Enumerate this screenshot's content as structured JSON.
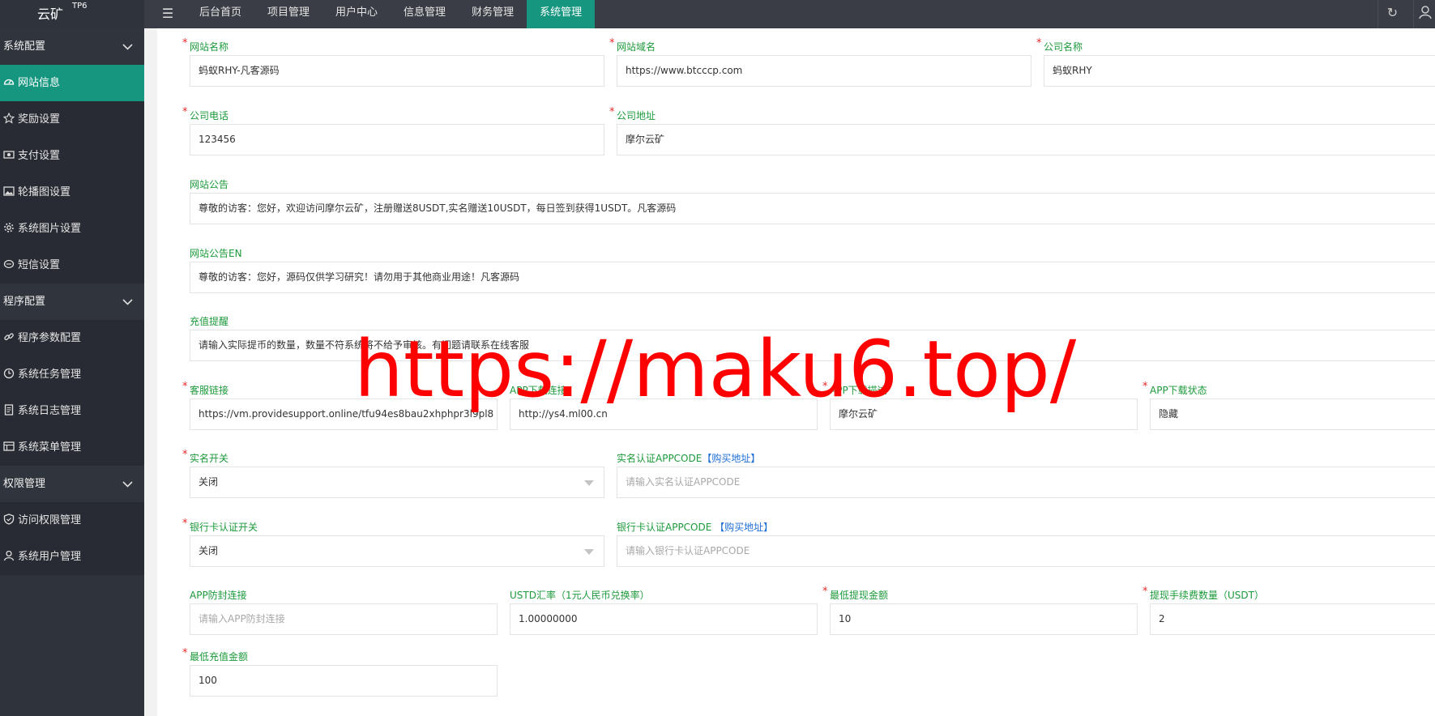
{
  "header": {
    "brand_name": "云矿",
    "brand_version": "TP6",
    "menu_toggle_icon": "hamburger-icon",
    "nav": [
      "后台首页",
      "项目管理",
      "用户中心",
      "信息管理",
      "财务管理",
      "系统管理"
    ],
    "active_nav": "系统管理",
    "refresh_icon": "refresh-icon",
    "user_icon": "user-icon"
  },
  "sidebar": {
    "group1": "系统配置",
    "group1_items": [
      {
        "label": "网站信息",
        "icon": "dashboard-icon",
        "active": true
      },
      {
        "label": "奖励设置",
        "icon": "star-icon"
      },
      {
        "label": "支付设置",
        "icon": "money-icon"
      },
      {
        "label": "轮播图设置",
        "icon": "image-icon"
      },
      {
        "label": "系统图片设置",
        "icon": "gear-icon"
      },
      {
        "label": "短信设置",
        "icon": "message-icon"
      }
    ],
    "group2": "程序配置",
    "group2_items": [
      {
        "label": "程序参数配置",
        "icon": "link-icon"
      },
      {
        "label": "系统任务管理",
        "icon": "clock-icon"
      },
      {
        "label": "系统日志管理",
        "icon": "log-icon"
      },
      {
        "label": "系统菜单管理",
        "icon": "menu-icon"
      }
    ],
    "group3": "权限管理",
    "group3_items": [
      {
        "label": "访问权限管理",
        "icon": "shield-icon"
      },
      {
        "label": "系统用户管理",
        "icon": "user-icon"
      }
    ]
  },
  "form": {
    "site_name": {
      "label": "网站名称",
      "value": "蚂蚁RHY-凡客源码"
    },
    "site_domain": {
      "label": "网站域名",
      "value": "https://www.btcccp.com"
    },
    "company_name": {
      "label": "公司名称",
      "value": "蚂蚁RHY"
    },
    "company_phone": {
      "label": "公司电话",
      "value": "123456"
    },
    "company_address": {
      "label": "公司地址",
      "value": "摩尔云矿"
    },
    "notice": {
      "label": "网站公告",
      "value": "尊敬的访客：您好，欢迎访问摩尔云矿，注册赠送8USDT,实名赠送10USDT，每日签到获得1USDT。凡客源码"
    },
    "notice_en": {
      "label": "网站公告EN",
      "value": "尊敬的访客：您好，源码仅供学习研究！请勿用于其他商业用途！凡客源码"
    },
    "recharge_tip": {
      "label": "充值提醒",
      "value": "请输入实际提币的数量，数量不符系统将不给予审核。有问题请联系在线客服"
    },
    "service_link": {
      "label": "客服链接",
      "value": "https://vm.providesupport.online/tfu94es8bau2xhphpr3l9pl8"
    },
    "app_link": {
      "label": "APP下载连接",
      "value": "http://ys4.ml00.cn"
    },
    "app_desc": {
      "label": "APP下载描述",
      "value": "摩尔云矿"
    },
    "app_status": {
      "label": "APP下载状态",
      "value": "隐藏"
    },
    "realname_switch": {
      "label": "实名开关",
      "value": "关闭"
    },
    "realname_appcode": {
      "label": "实名认证APPCODE",
      "link": "【购买地址】",
      "placeholder": "请输入实名认证APPCODE"
    },
    "bankcard_switch": {
      "label": "银行卡认证开关",
      "value": "关闭"
    },
    "bankcard_appcode": {
      "label": "银行卡认证APPCODE",
      "link": "【购买地址】",
      "placeholder": "请输入银行卡认证APPCODE"
    },
    "app_anti_block": {
      "label": "APP防封连接",
      "placeholder": "请输入APP防封连接"
    },
    "usdt_rate": {
      "label": "USTD汇率（1元人民币兑换率）",
      "value": "1.00000000"
    },
    "min_withdraw": {
      "label": "最低提现金额",
      "value": "10"
    },
    "withdraw_fee": {
      "label": "提现手续费数量（USDT）",
      "value": "2"
    },
    "min_recharge": {
      "label": "最低充值金额",
      "value": "100"
    }
  },
  "watermark": "https://maku6.top/"
}
